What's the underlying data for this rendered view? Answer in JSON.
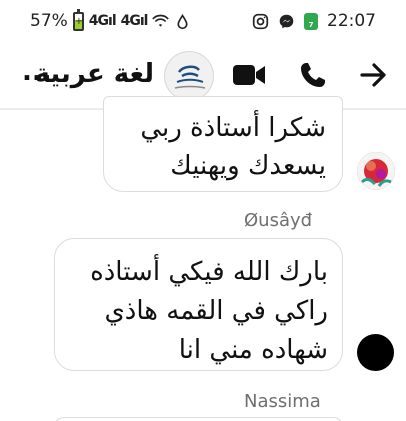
{
  "status_bar": {
    "battery_percent": "57%",
    "signal_1": "4G",
    "signal_2": "4G",
    "time": "22:07",
    "badge_label": "7"
  },
  "header": {
    "title": "لغة عربية",
    "ellipsis": "...",
    "icons": [
      "back-arrow-icon",
      "phone-icon",
      "video-camera-icon"
    ]
  },
  "messages": [
    {
      "text": "شكرا أستاذة ربي يسعدك ويهنيك",
      "avatar_color": "#e63946"
    },
    {
      "sender": "Øusâyđ",
      "text": "بارك الله فيكي أستاذه راكي في القمه هاذي شهاده مني انا",
      "avatar_color": "#000000"
    },
    {
      "sender": "Nassima"
    }
  ]
}
